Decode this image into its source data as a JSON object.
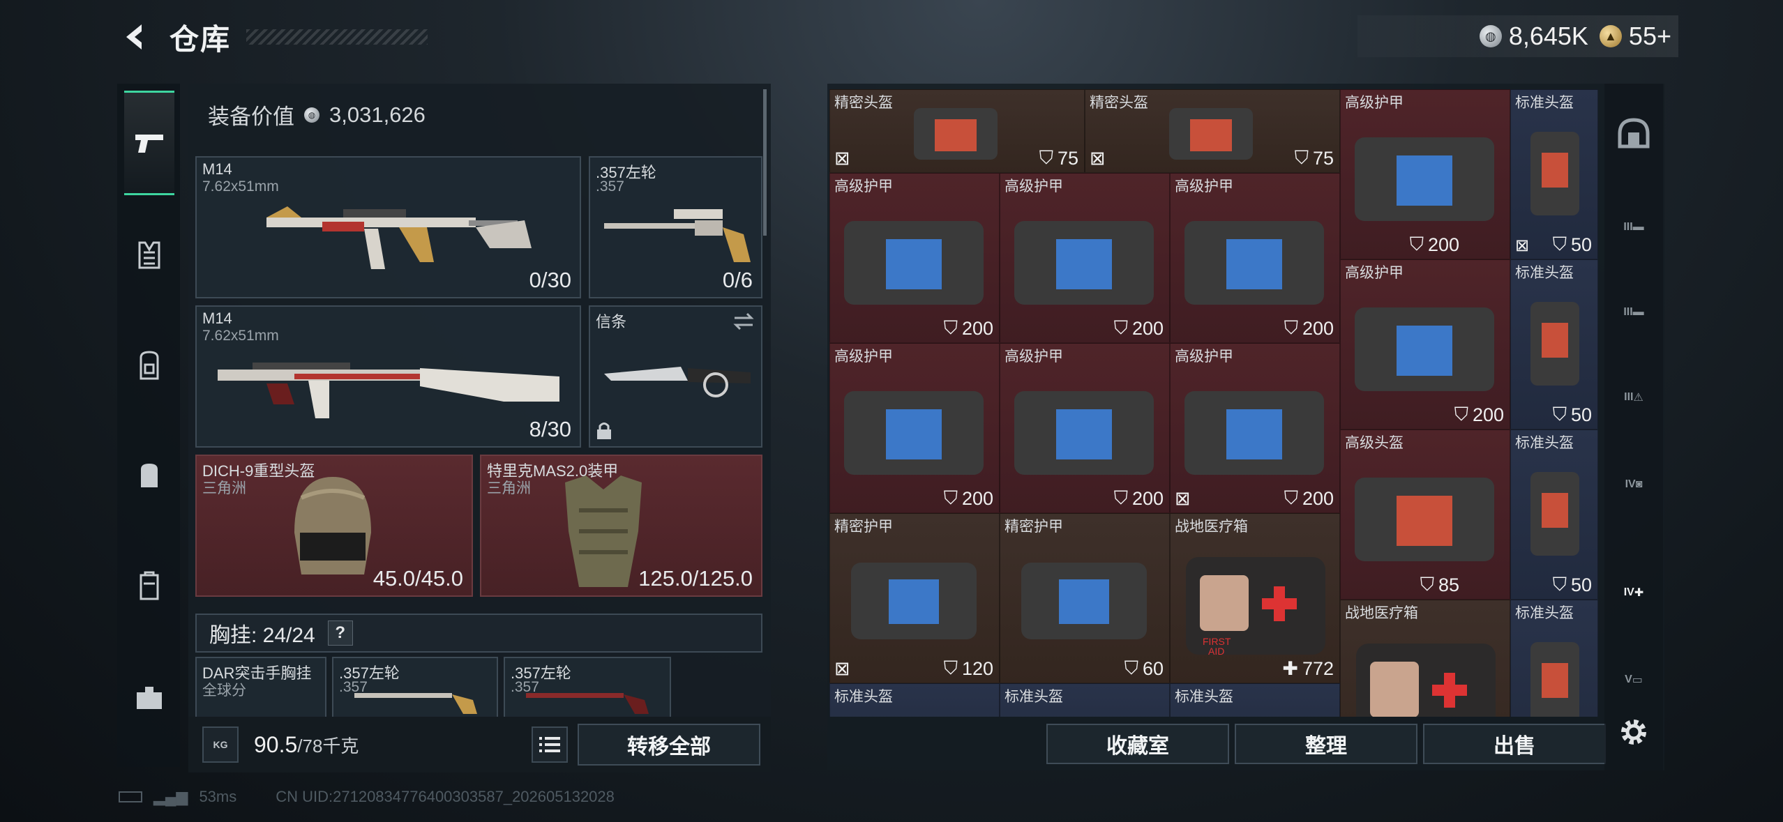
{
  "header": {
    "title": "仓库",
    "currency_1": "8,645K",
    "currency_2": "55+"
  },
  "left_panel": {
    "equip_value_label": "装备价值",
    "equip_value": "3,031,626",
    "slots": [
      {
        "name": "M14",
        "sub": "7.62x51mm",
        "count": "0/30"
      },
      {
        "name": ".357左轮",
        "sub": ".357",
        "count": "0/6"
      },
      {
        "name": "M14",
        "sub": "7.62x51mm",
        "count": "8/30"
      },
      {
        "name": "信条",
        "sub": "",
        "count": ""
      },
      {
        "name": "DICH-9重型头盔",
        "sub": "三角洲",
        "count": "45.0/45.0"
      },
      {
        "name": "特里克MAS2.0装甲",
        "sub": "三角洲",
        "count": "125.0/125.0"
      }
    ],
    "chest_rig_label": "胸挂: 24/24",
    "help": "?",
    "rig_items": [
      {
        "name": "DAR突击手胸挂",
        "sub": "全球分"
      },
      {
        "name": ".357左轮",
        "sub": ".357"
      },
      {
        "name": ".357左轮",
        "sub": ".357"
      }
    ],
    "weight_value": "90.5",
    "weight_unit": "/78千克",
    "weight_icon": "KG",
    "transfer_all": "转移全部"
  },
  "grid_items": [
    {
      "name": "精密头盔",
      "stat": "75"
    },
    {
      "name": "精密头盔",
      "stat": "75"
    },
    {
      "name": "高级护甲",
      "stat": "200",
      "stat2": "50"
    },
    {
      "name": "标准头盔",
      "stat": "50"
    },
    {
      "name": "高级护甲",
      "stat": "200"
    },
    {
      "name": "高级护甲",
      "stat": "200"
    },
    {
      "name": "高级护甲",
      "stat": "200"
    },
    {
      "name": "高级护甲",
      "stat": "200",
      "stat2": "50"
    },
    {
      "name": "标准头盔",
      "stat": "50"
    },
    {
      "name": "高级护甲",
      "stat": "200"
    },
    {
      "name": "高级护甲",
      "stat": "200"
    },
    {
      "name": "高级护甲",
      "stat": "200"
    },
    {
      "name": "高级头盔",
      "stat": "85",
      "stat2": "50"
    },
    {
      "name": "标准头盔",
      "stat": "50"
    },
    {
      "name": "精密护甲",
      "stat": "120"
    },
    {
      "name": "精密护甲",
      "stat": "60"
    },
    {
      "name": "战地医疗箱",
      "stat": "772"
    },
    {
      "name": "战地医疗箱",
      "stat": ""
    },
    {
      "name": "标准头盔",
      "stat": ""
    },
    {
      "name": "标准头盔",
      "stat": ""
    },
    {
      "name": "标准头盔",
      "stat": ""
    },
    {
      "name": "标准头盔",
      "stat": ""
    }
  ],
  "medkit_label_1": "FIRST",
  "medkit_label_2": "AID",
  "actions": {
    "collection": "收藏室",
    "sort": "整理",
    "sell": "出售"
  },
  "right_rail": [
    "III",
    "III",
    "III",
    "IV",
    "IV",
    "V"
  ],
  "status": {
    "ping": "53ms",
    "uid": "CN UID:2712083477640030358​7_202605132028"
  },
  "colors": {
    "accent": "#3ed6a0",
    "slot_red": "#4f2429",
    "slot_brown": "#3e302a",
    "slot_blue": "#29334a"
  }
}
